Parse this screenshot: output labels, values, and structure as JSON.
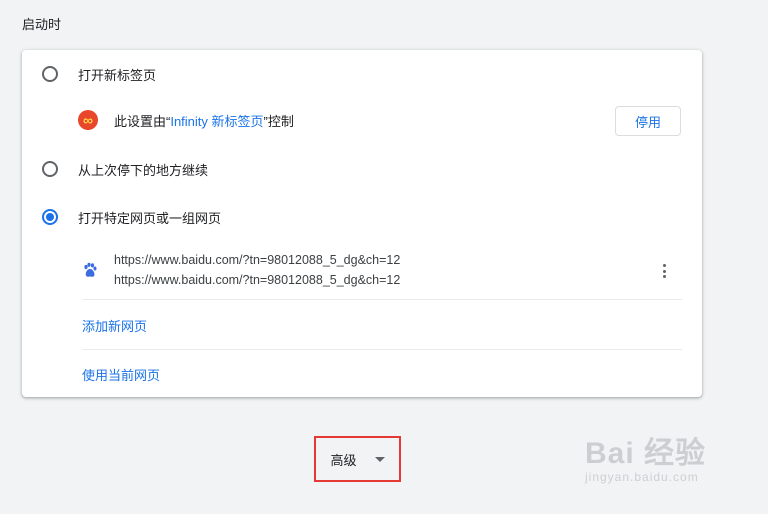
{
  "section": {
    "title": "启动时"
  },
  "options": [
    {
      "label": "打开新标签页",
      "checked": false
    },
    {
      "label": "从上次停下的地方继续",
      "checked": false
    },
    {
      "label": "打开特定网页或一组网页",
      "checked": true
    }
  ],
  "extension_notice": {
    "prefix": "此设置由“",
    "extension_name": "Infinity 新标签页",
    "suffix": "”控制",
    "disable_button": "停用",
    "icon": "infinity-icon"
  },
  "pages": [
    {
      "title": "https://www.baidu.com/?tn=98012088_5_dg&ch=12",
      "url": "https://www.baidu.com/?tn=98012088_5_dg&ch=12",
      "icon": "baidu-paw-icon"
    }
  ],
  "actions": {
    "add_page": "添加新网页",
    "use_current": "使用当前网页"
  },
  "advanced": {
    "label": "高级"
  },
  "watermark": {
    "main": "Bai 经验",
    "sub": "jingyan.baidu.com"
  },
  "colors": {
    "accent": "#1a73e8",
    "highlight_border": "#e53935",
    "background": "#f1f3f4"
  }
}
